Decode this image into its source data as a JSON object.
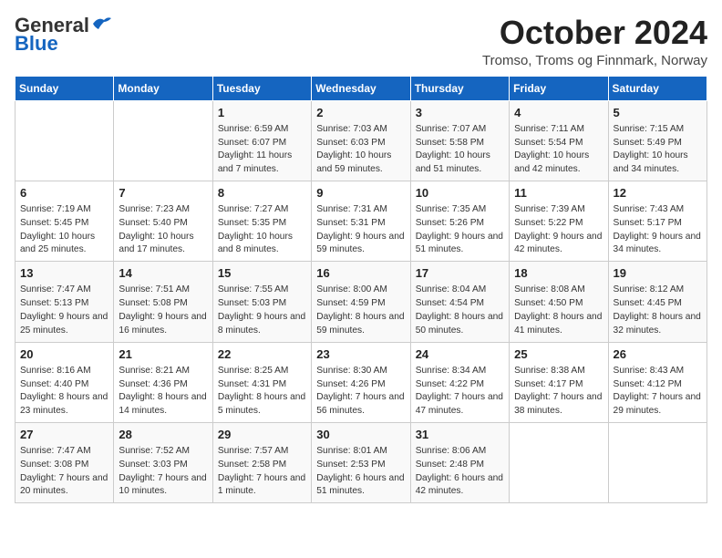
{
  "logo": {
    "general": "General",
    "blue": "Blue"
  },
  "title": "October 2024",
  "subtitle": "Tromso, Troms og Finnmark, Norway",
  "days_of_week": [
    "Sunday",
    "Monday",
    "Tuesday",
    "Wednesday",
    "Thursday",
    "Friday",
    "Saturday"
  ],
  "weeks": [
    [
      {
        "day": "",
        "content": ""
      },
      {
        "day": "",
        "content": ""
      },
      {
        "day": "1",
        "content": "Sunrise: 6:59 AM\nSunset: 6:07 PM\nDaylight: 11 hours\nand 7 minutes."
      },
      {
        "day": "2",
        "content": "Sunrise: 7:03 AM\nSunset: 6:03 PM\nDaylight: 10 hours\nand 59 minutes."
      },
      {
        "day": "3",
        "content": "Sunrise: 7:07 AM\nSunset: 5:58 PM\nDaylight: 10 hours\nand 51 minutes."
      },
      {
        "day": "4",
        "content": "Sunrise: 7:11 AM\nSunset: 5:54 PM\nDaylight: 10 hours\nand 42 minutes."
      },
      {
        "day": "5",
        "content": "Sunrise: 7:15 AM\nSunset: 5:49 PM\nDaylight: 10 hours\nand 34 minutes."
      }
    ],
    [
      {
        "day": "6",
        "content": "Sunrise: 7:19 AM\nSunset: 5:45 PM\nDaylight: 10 hours\nand 25 minutes."
      },
      {
        "day": "7",
        "content": "Sunrise: 7:23 AM\nSunset: 5:40 PM\nDaylight: 10 hours\nand 17 minutes."
      },
      {
        "day": "8",
        "content": "Sunrise: 7:27 AM\nSunset: 5:35 PM\nDaylight: 10 hours\nand 8 minutes."
      },
      {
        "day": "9",
        "content": "Sunrise: 7:31 AM\nSunset: 5:31 PM\nDaylight: 9 hours\nand 59 minutes."
      },
      {
        "day": "10",
        "content": "Sunrise: 7:35 AM\nSunset: 5:26 PM\nDaylight: 9 hours\nand 51 minutes."
      },
      {
        "day": "11",
        "content": "Sunrise: 7:39 AM\nSunset: 5:22 PM\nDaylight: 9 hours\nand 42 minutes."
      },
      {
        "day": "12",
        "content": "Sunrise: 7:43 AM\nSunset: 5:17 PM\nDaylight: 9 hours\nand 34 minutes."
      }
    ],
    [
      {
        "day": "13",
        "content": "Sunrise: 7:47 AM\nSunset: 5:13 PM\nDaylight: 9 hours\nand 25 minutes."
      },
      {
        "day": "14",
        "content": "Sunrise: 7:51 AM\nSunset: 5:08 PM\nDaylight: 9 hours\nand 16 minutes."
      },
      {
        "day": "15",
        "content": "Sunrise: 7:55 AM\nSunset: 5:03 PM\nDaylight: 9 hours\nand 8 minutes."
      },
      {
        "day": "16",
        "content": "Sunrise: 8:00 AM\nSunset: 4:59 PM\nDaylight: 8 hours\nand 59 minutes."
      },
      {
        "day": "17",
        "content": "Sunrise: 8:04 AM\nSunset: 4:54 PM\nDaylight: 8 hours\nand 50 minutes."
      },
      {
        "day": "18",
        "content": "Sunrise: 8:08 AM\nSunset: 4:50 PM\nDaylight: 8 hours\nand 41 minutes."
      },
      {
        "day": "19",
        "content": "Sunrise: 8:12 AM\nSunset: 4:45 PM\nDaylight: 8 hours\nand 32 minutes."
      }
    ],
    [
      {
        "day": "20",
        "content": "Sunrise: 8:16 AM\nSunset: 4:40 PM\nDaylight: 8 hours\nand 23 minutes."
      },
      {
        "day": "21",
        "content": "Sunrise: 8:21 AM\nSunset: 4:36 PM\nDaylight: 8 hours\nand 14 minutes."
      },
      {
        "day": "22",
        "content": "Sunrise: 8:25 AM\nSunset: 4:31 PM\nDaylight: 8 hours\nand 5 minutes."
      },
      {
        "day": "23",
        "content": "Sunrise: 8:30 AM\nSunset: 4:26 PM\nDaylight: 7 hours\nand 56 minutes."
      },
      {
        "day": "24",
        "content": "Sunrise: 8:34 AM\nSunset: 4:22 PM\nDaylight: 7 hours\nand 47 minutes."
      },
      {
        "day": "25",
        "content": "Sunrise: 8:38 AM\nSunset: 4:17 PM\nDaylight: 7 hours\nand 38 minutes."
      },
      {
        "day": "26",
        "content": "Sunrise: 8:43 AM\nSunset: 4:12 PM\nDaylight: 7 hours\nand 29 minutes."
      }
    ],
    [
      {
        "day": "27",
        "content": "Sunrise: 7:47 AM\nSunset: 3:08 PM\nDaylight: 7 hours\nand 20 minutes."
      },
      {
        "day": "28",
        "content": "Sunrise: 7:52 AM\nSunset: 3:03 PM\nDaylight: 7 hours\nand 10 minutes."
      },
      {
        "day": "29",
        "content": "Sunrise: 7:57 AM\nSunset: 2:58 PM\nDaylight: 7 hours\nand 1 minute."
      },
      {
        "day": "30",
        "content": "Sunrise: 8:01 AM\nSunset: 2:53 PM\nDaylight: 6 hours\nand 51 minutes."
      },
      {
        "day": "31",
        "content": "Sunrise: 8:06 AM\nSunset: 2:48 PM\nDaylight: 6 hours\nand 42 minutes."
      },
      {
        "day": "",
        "content": ""
      },
      {
        "day": "",
        "content": ""
      }
    ]
  ]
}
